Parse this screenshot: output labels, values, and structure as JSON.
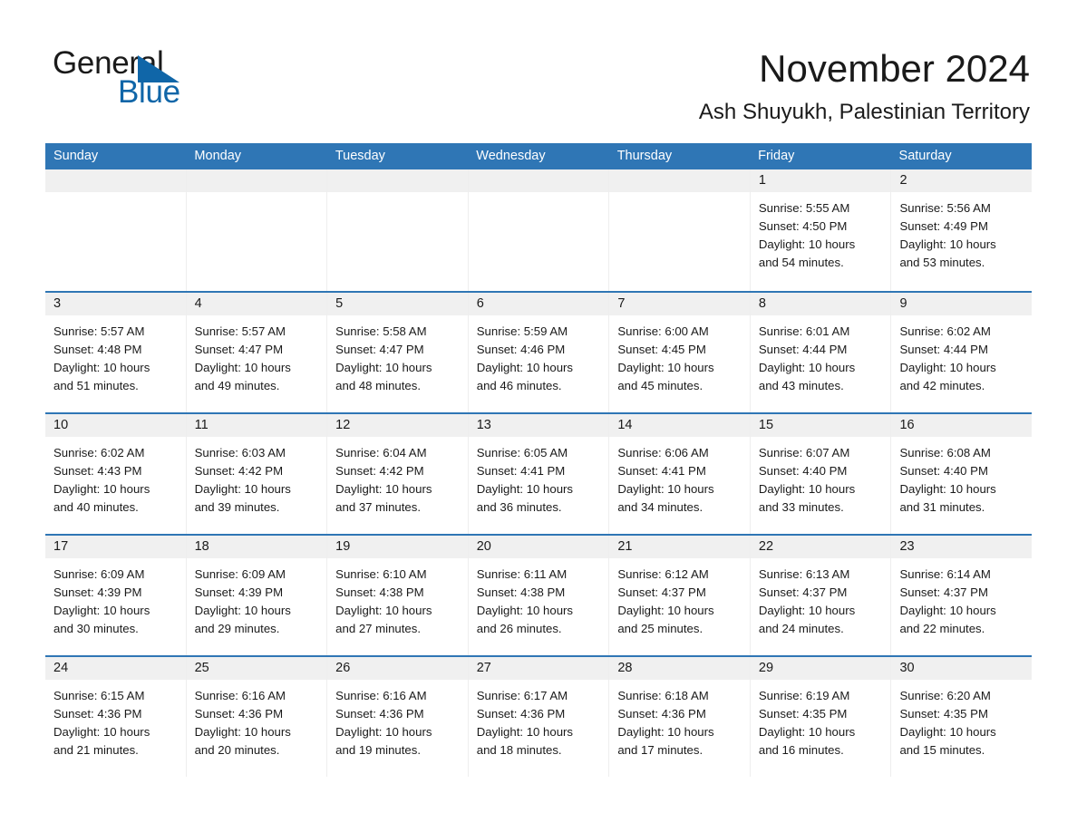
{
  "brand": {
    "name_part1": "General",
    "name_part2": "Blue",
    "accent_color": "#1066a8"
  },
  "header": {
    "month_title": "November 2024",
    "location": "Ash Shuyukh, Palestinian Territory"
  },
  "calendar": {
    "header_color": "#2f76b5",
    "weekdays": [
      "Sunday",
      "Monday",
      "Tuesday",
      "Wednesday",
      "Thursday",
      "Friday",
      "Saturday"
    ],
    "weeks": [
      [
        {
          "day": "",
          "lines": []
        },
        {
          "day": "",
          "lines": []
        },
        {
          "day": "",
          "lines": []
        },
        {
          "day": "",
          "lines": []
        },
        {
          "day": "",
          "lines": []
        },
        {
          "day": "1",
          "lines": [
            "Sunrise: 5:55 AM",
            "Sunset: 4:50 PM",
            "Daylight: 10 hours",
            "and 54 minutes."
          ]
        },
        {
          "day": "2",
          "lines": [
            "Sunrise: 5:56 AM",
            "Sunset: 4:49 PM",
            "Daylight: 10 hours",
            "and 53 minutes."
          ]
        }
      ],
      [
        {
          "day": "3",
          "lines": [
            "Sunrise: 5:57 AM",
            "Sunset: 4:48 PM",
            "Daylight: 10 hours",
            "and 51 minutes."
          ]
        },
        {
          "day": "4",
          "lines": [
            "Sunrise: 5:57 AM",
            "Sunset: 4:47 PM",
            "Daylight: 10 hours",
            "and 49 minutes."
          ]
        },
        {
          "day": "5",
          "lines": [
            "Sunrise: 5:58 AM",
            "Sunset: 4:47 PM",
            "Daylight: 10 hours",
            "and 48 minutes."
          ]
        },
        {
          "day": "6",
          "lines": [
            "Sunrise: 5:59 AM",
            "Sunset: 4:46 PM",
            "Daylight: 10 hours",
            "and 46 minutes."
          ]
        },
        {
          "day": "7",
          "lines": [
            "Sunrise: 6:00 AM",
            "Sunset: 4:45 PM",
            "Daylight: 10 hours",
            "and 45 minutes."
          ]
        },
        {
          "day": "8",
          "lines": [
            "Sunrise: 6:01 AM",
            "Sunset: 4:44 PM",
            "Daylight: 10 hours",
            "and 43 minutes."
          ]
        },
        {
          "day": "9",
          "lines": [
            "Sunrise: 6:02 AM",
            "Sunset: 4:44 PM",
            "Daylight: 10 hours",
            "and 42 minutes."
          ]
        }
      ],
      [
        {
          "day": "10",
          "lines": [
            "Sunrise: 6:02 AM",
            "Sunset: 4:43 PM",
            "Daylight: 10 hours",
            "and 40 minutes."
          ]
        },
        {
          "day": "11",
          "lines": [
            "Sunrise: 6:03 AM",
            "Sunset: 4:42 PM",
            "Daylight: 10 hours",
            "and 39 minutes."
          ]
        },
        {
          "day": "12",
          "lines": [
            "Sunrise: 6:04 AM",
            "Sunset: 4:42 PM",
            "Daylight: 10 hours",
            "and 37 minutes."
          ]
        },
        {
          "day": "13",
          "lines": [
            "Sunrise: 6:05 AM",
            "Sunset: 4:41 PM",
            "Daylight: 10 hours",
            "and 36 minutes."
          ]
        },
        {
          "day": "14",
          "lines": [
            "Sunrise: 6:06 AM",
            "Sunset: 4:41 PM",
            "Daylight: 10 hours",
            "and 34 minutes."
          ]
        },
        {
          "day": "15",
          "lines": [
            "Sunrise: 6:07 AM",
            "Sunset: 4:40 PM",
            "Daylight: 10 hours",
            "and 33 minutes."
          ]
        },
        {
          "day": "16",
          "lines": [
            "Sunrise: 6:08 AM",
            "Sunset: 4:40 PM",
            "Daylight: 10 hours",
            "and 31 minutes."
          ]
        }
      ],
      [
        {
          "day": "17",
          "lines": [
            "Sunrise: 6:09 AM",
            "Sunset: 4:39 PM",
            "Daylight: 10 hours",
            "and 30 minutes."
          ]
        },
        {
          "day": "18",
          "lines": [
            "Sunrise: 6:09 AM",
            "Sunset: 4:39 PM",
            "Daylight: 10 hours",
            "and 29 minutes."
          ]
        },
        {
          "day": "19",
          "lines": [
            "Sunrise: 6:10 AM",
            "Sunset: 4:38 PM",
            "Daylight: 10 hours",
            "and 27 minutes."
          ]
        },
        {
          "day": "20",
          "lines": [
            "Sunrise: 6:11 AM",
            "Sunset: 4:38 PM",
            "Daylight: 10 hours",
            "and 26 minutes."
          ]
        },
        {
          "day": "21",
          "lines": [
            "Sunrise: 6:12 AM",
            "Sunset: 4:37 PM",
            "Daylight: 10 hours",
            "and 25 minutes."
          ]
        },
        {
          "day": "22",
          "lines": [
            "Sunrise: 6:13 AM",
            "Sunset: 4:37 PM",
            "Daylight: 10 hours",
            "and 24 minutes."
          ]
        },
        {
          "day": "23",
          "lines": [
            "Sunrise: 6:14 AM",
            "Sunset: 4:37 PM",
            "Daylight: 10 hours",
            "and 22 minutes."
          ]
        }
      ],
      [
        {
          "day": "24",
          "lines": [
            "Sunrise: 6:15 AM",
            "Sunset: 4:36 PM",
            "Daylight: 10 hours",
            "and 21 minutes."
          ]
        },
        {
          "day": "25",
          "lines": [
            "Sunrise: 6:16 AM",
            "Sunset: 4:36 PM",
            "Daylight: 10 hours",
            "and 20 minutes."
          ]
        },
        {
          "day": "26",
          "lines": [
            "Sunrise: 6:16 AM",
            "Sunset: 4:36 PM",
            "Daylight: 10 hours",
            "and 19 minutes."
          ]
        },
        {
          "day": "27",
          "lines": [
            "Sunrise: 6:17 AM",
            "Sunset: 4:36 PM",
            "Daylight: 10 hours",
            "and 18 minutes."
          ]
        },
        {
          "day": "28",
          "lines": [
            "Sunrise: 6:18 AM",
            "Sunset: 4:36 PM",
            "Daylight: 10 hours",
            "and 17 minutes."
          ]
        },
        {
          "day": "29",
          "lines": [
            "Sunrise: 6:19 AM",
            "Sunset: 4:35 PM",
            "Daylight: 10 hours",
            "and 16 minutes."
          ]
        },
        {
          "day": "30",
          "lines": [
            "Sunrise: 6:20 AM",
            "Sunset: 4:35 PM",
            "Daylight: 10 hours",
            "and 15 minutes."
          ]
        }
      ]
    ]
  }
}
